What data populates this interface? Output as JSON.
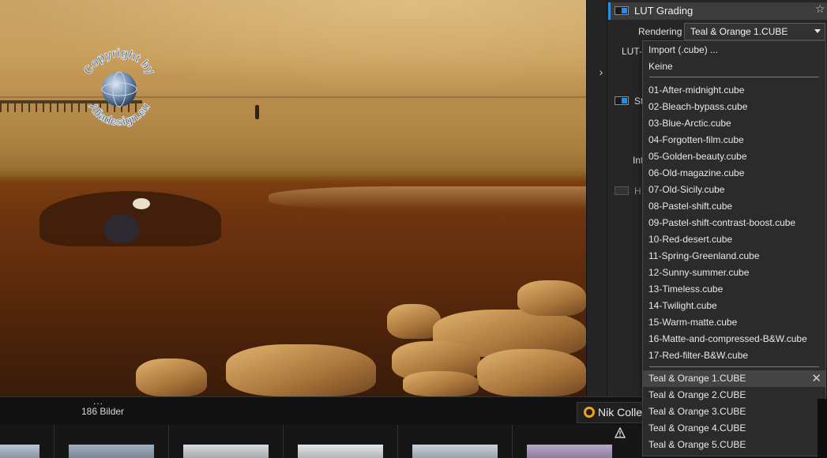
{
  "panel": {
    "section_title": "LUT Grading",
    "rendering_label": "Rendering",
    "rendering_value": "Teal & Orange 1.CUBE",
    "fragments": {
      "lut": "LUT-",
      "st": "St",
      "int": "Int",
      "h": "H"
    }
  },
  "dropdown": {
    "actions": [
      "Import (.cube) ...",
      "Keine"
    ],
    "luts": [
      "01-After-midnight.cube",
      "02-Bleach-bypass.cube",
      "03-Blue-Arctic.cube",
      "04-Forgotten-film.cube",
      "05-Golden-beauty.cube",
      "06-Old-magazine.cube",
      "07-Old-Sicily.cube",
      "08-Pastel-shift.cube",
      "09-Pastel-shift-contrast-boost.cube",
      "10-Red-desert.cube",
      "11-Spring-Greenland.cube",
      "12-Sunny-summer.cube",
      "13-Timeless.cube",
      "14-Twilight.cube",
      "15-Warm-matte.cube",
      "16-Matte-and-compressed-B&W.cube",
      "17-Red-filter-B&W.cube"
    ],
    "custom": [
      "Teal & Orange 1.CUBE",
      "Teal & Orange 2.CUBE",
      "Teal & Orange 3.CUBE",
      "Teal & Orange 4.CUBE",
      "Teal & Orange 5.CUBE"
    ],
    "selected_index": 0,
    "remove_glyph": "✕"
  },
  "filmstrip": {
    "dots": "...",
    "count": "186 Bilder",
    "plugin_tab": "Nik Colle"
  },
  "watermark": {
    "text_top": "Copyright by",
    "text_bottom": "Aliadesign.eu"
  },
  "icons": {
    "collapse": "chevron-right-icon",
    "star": "star-icon",
    "caret": "chevron-down-icon",
    "warning": "warning-icon"
  },
  "colors": {
    "accent": "#1f8ef0",
    "plugin": "#f0a020"
  }
}
